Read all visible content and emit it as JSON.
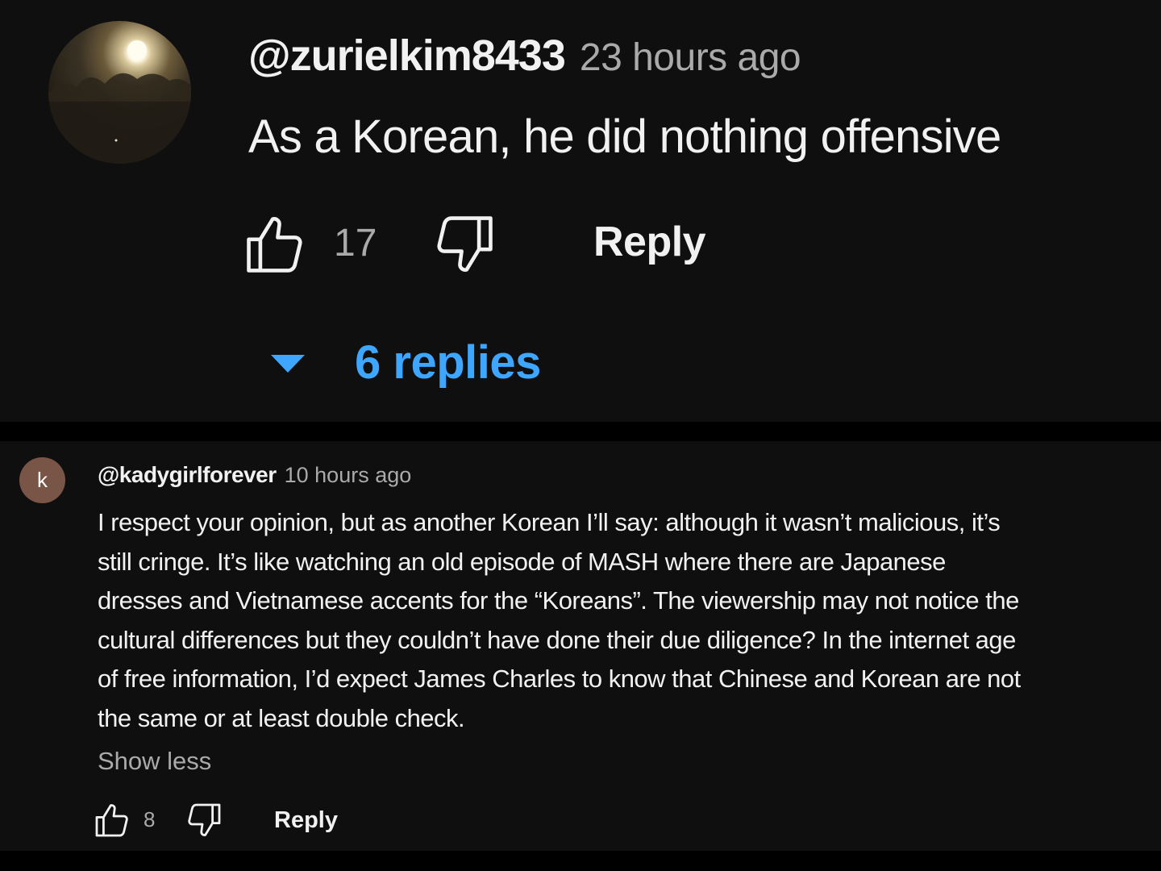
{
  "top_comment": {
    "handle": "@zurielkim8433",
    "time": "23 hours ago",
    "text": "As a Korean, he did nothing offensive",
    "like_count": "17",
    "reply_label": "Reply",
    "replies_label": "6 replies",
    "avatar_icon": "avatar-photo-icon"
  },
  "reply_comment": {
    "avatar_letter": "k",
    "avatar_color": "#795548",
    "handle": "@kadygirlforever",
    "time": "10 hours ago",
    "text_lines": [
      "I respect your opinion, but as another Korean I’ll say: although it wasn’t malicious, it’s",
      "still cringe. It’s like watching an old episode of MASH where there are Japanese",
      "dresses and Vietnamese accents for the “Koreans”. The viewership may not notice the",
      "cultural differences but they couldn’t have done their due diligence? In the internet age",
      "of free information, I’d expect James Charles to know that Chinese and Korean are not",
      "the same or at least double check."
    ],
    "show_less_label": "Show less",
    "like_count": "8",
    "reply_label": "Reply"
  },
  "colors": {
    "background": "#0f0f0f",
    "link_blue": "#3ea6ff",
    "secondary_text": "#aaaaaa",
    "primary_text": "#f1f1f1"
  },
  "icons": [
    "thumbs-up-icon",
    "thumbs-down-icon",
    "expand-triangle-icon"
  ]
}
